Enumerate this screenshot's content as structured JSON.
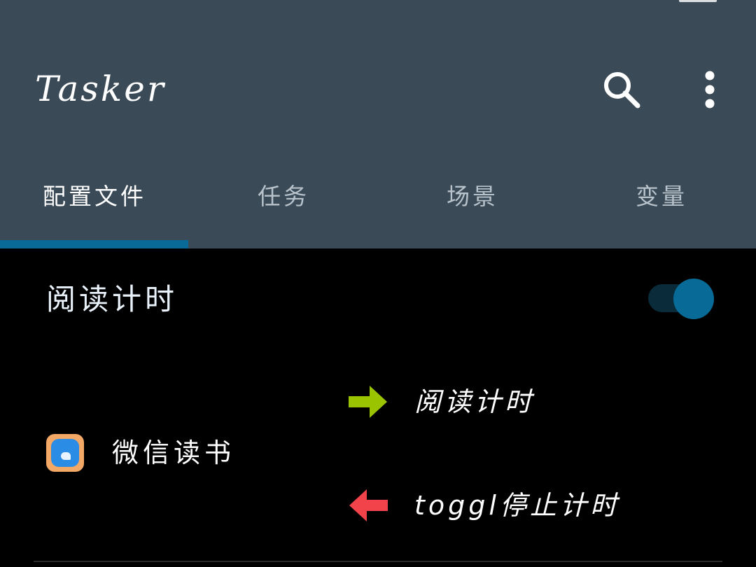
{
  "app_bar": {
    "title": "Tasker",
    "search_icon": "search-icon",
    "more_icon": "more-vert-icon"
  },
  "tabs": [
    {
      "label": "配置文件",
      "active": true
    },
    {
      "label": "任务",
      "active": false
    },
    {
      "label": "场景",
      "active": false
    },
    {
      "label": "变量",
      "active": false
    }
  ],
  "profile": {
    "name": "阅读计时",
    "enabled": true,
    "context": {
      "icon": "weread-app-icon",
      "label": "微信读书"
    },
    "enter_task": {
      "icon": "arrow-right-icon",
      "label": "阅读计时"
    },
    "exit_task": {
      "icon": "arrow-left-icon",
      "label": "toggl停止计时"
    }
  },
  "colors": {
    "appbar": "#3a4a57",
    "accent": "#0a6a97",
    "enter_arrow": "#9bc400",
    "exit_arrow": "#f2424a",
    "icon_orange": "#f3a965",
    "icon_blue": "#2b8ce6"
  }
}
